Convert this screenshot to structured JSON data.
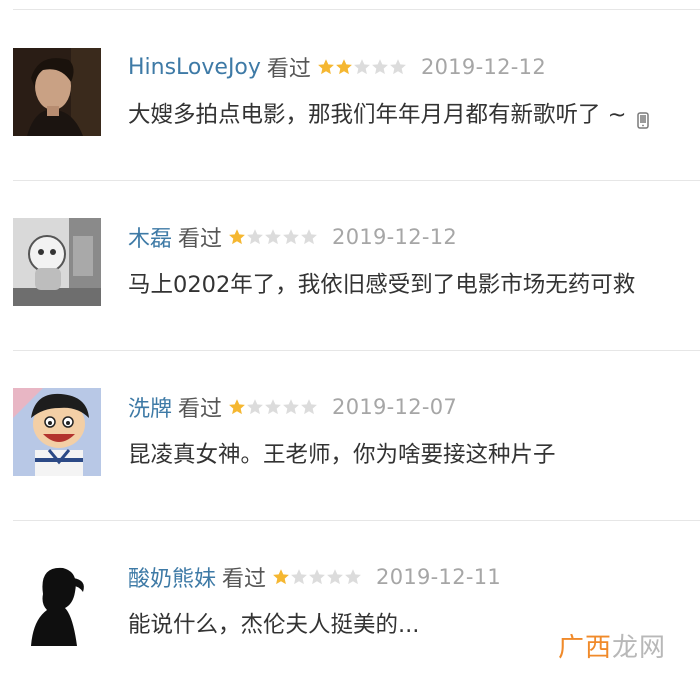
{
  "reviews": [
    {
      "user": "HinsLoveJoy",
      "status": "看过",
      "rating": 2,
      "max_rating": 5,
      "date": "2019-12-12",
      "comment": "大嫂多拍点电影，那我们年年月月都有新歌听了 ~",
      "mobile": true,
      "avatar_icon": "man-portrait"
    },
    {
      "user": "木磊",
      "status": "看过",
      "rating": 1,
      "max_rating": 5,
      "date": "2019-12-12",
      "comment": "马上0202年了，我依旧感受到了电影市场无药可救",
      "mobile": false,
      "avatar_icon": "figurine-photo"
    },
    {
      "user": "洗牌",
      "status": "看过",
      "rating": 1,
      "max_rating": 5,
      "date": "2019-12-07",
      "comment": "昆凌真女神。王老师，你为啥要接这种片子",
      "mobile": false,
      "avatar_icon": "cartoon-boy"
    },
    {
      "user": "酸奶熊妹",
      "status": "看过",
      "rating": 1,
      "max_rating": 5,
      "date": "2019-12-11",
      "comment": "能说什么，杰伦夫人挺美的...",
      "mobile": false,
      "avatar_icon": "woman-silhouette"
    }
  ],
  "watermark": {
    "part1": "广西",
    "part2": "龙网"
  },
  "colors": {
    "username": "#3e7aa6",
    "star_on": "#f5b731",
    "star_off": "#dcdcdc",
    "date": "#a6a6a6"
  }
}
